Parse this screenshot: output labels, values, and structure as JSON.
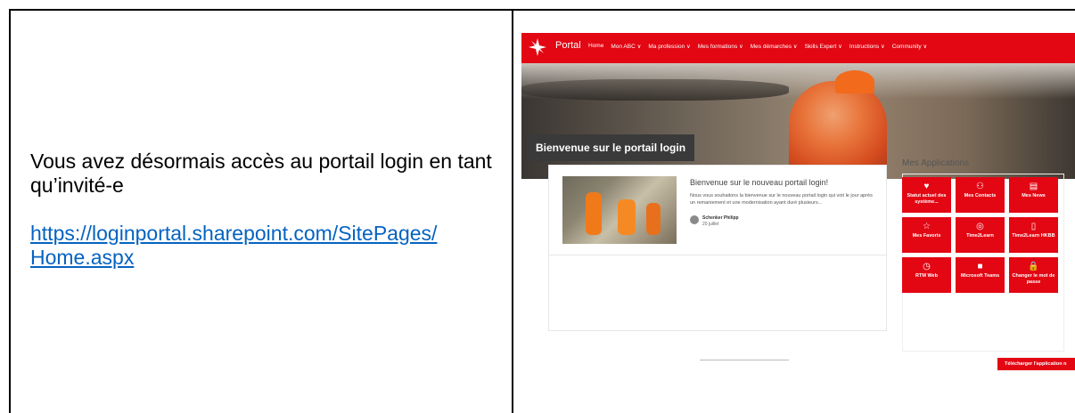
{
  "left": {
    "text": "Vous avez désormais accès au portail login en tant qu’invité-e",
    "link": "https://loginportal.sharepoint.com/SitePages/Home.aspx",
    "link_line1": "https://loginportal.sharepoint.com/SitePages/",
    "link_line2": "Home.aspx"
  },
  "portal": {
    "name": "Portal",
    "menu": [
      "Home",
      "Mon ABC ∨",
      "Ma profession ∨",
      "Mes formations ∨",
      "Mes démarches ∨",
      "Skills Expert ∨",
      "Instructions ∨",
      "Community ∨"
    ],
    "hero_title": "Bienvenue sur le portail login",
    "news": {
      "title": "Bienvenue sur le nouveau portail login!",
      "desc": "Nous vous souhaitons la bienvenue sur le nouveau portail login qui voit le jour après un remaniement et une modernisation ayant duré plusieurs...",
      "author": "Schenker Philipp",
      "date": "20 juillet"
    },
    "apps_title": "Mes Applications",
    "apps": [
      {
        "icon": "heart-icon",
        "glyph": "♥",
        "label": "Statut actuel des système..."
      },
      {
        "icon": "contacts-icon",
        "glyph": "⚇",
        "label": "Mes Contacts"
      },
      {
        "icon": "news-icon",
        "glyph": "▤",
        "label": "Mes News"
      },
      {
        "icon": "favorites-icon",
        "glyph": "☆",
        "label": "Mes Favoris"
      },
      {
        "icon": "learn-icon",
        "glyph": "◎",
        "label": "Time2Learn"
      },
      {
        "icon": "book-icon",
        "glyph": "▯",
        "label": "Time2Learn HKBB"
      },
      {
        "icon": "clock-icon",
        "glyph": "◷",
        "label": "RTM Web"
      },
      {
        "icon": "teams-icon",
        "glyph": "■",
        "label": "Microsoft Teams"
      },
      {
        "icon": "lock-icon",
        "glyph": "🔒",
        "label": "Changer le mot de passe"
      }
    ],
    "download_label": "Télécharger l'application n"
  },
  "colors": {
    "brand": "#e30613",
    "link": "#0563c1"
  }
}
